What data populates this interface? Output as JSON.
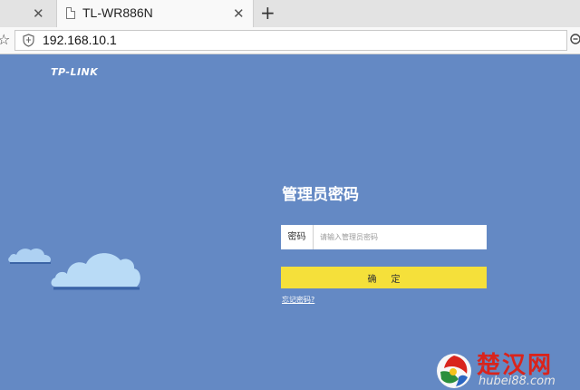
{
  "browser": {
    "tabs": [
      {
        "title": ""
      },
      {
        "title": "TL-WR886N",
        "active": true
      }
    ],
    "address": "192.168.10.1",
    "icons": [
      "close-icon",
      "page-icon",
      "plus-icon",
      "star-icon",
      "shield-icon",
      "zoom-icon"
    ]
  },
  "page": {
    "background_color": "#6489c4",
    "brand": "TP-LINK",
    "login": {
      "heading": "管理员密码",
      "password_label": "密码",
      "password_placeholder": "请输入管理员密码",
      "password_value": "",
      "confirm_label": "确定",
      "confirm_color": "#f5e03a",
      "forgot_link": "忘记密码?"
    },
    "decor": [
      "cloud-small",
      "cloud-large"
    ]
  },
  "watermark": {
    "title": "楚汉网",
    "subtitle": "hubei88.com",
    "title_color": "#d9241c"
  }
}
